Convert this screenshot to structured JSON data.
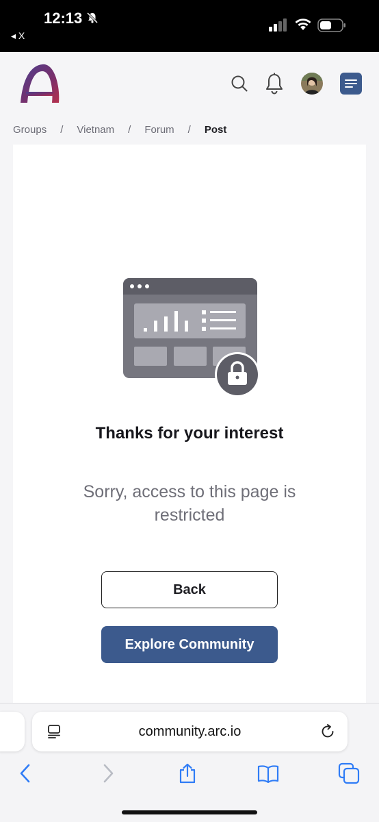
{
  "status_bar": {
    "time": "12:13",
    "back_app": "◂ X"
  },
  "header": {
    "logo_icon": "arc-logo-icon",
    "search_icon": "search-icon",
    "notifications_icon": "bell-icon",
    "menu_icon": "menu-icon",
    "accent_color": "#3c5a8d"
  },
  "breadcrumb": {
    "items": [
      "Groups",
      "Vietnam",
      "Forum"
    ],
    "separator": "/",
    "current": "Post"
  },
  "restricted": {
    "title": "Thanks for your interest",
    "message": "Sorry, access to this page is restricted",
    "back_label": "Back",
    "explore_label": "Explore Community"
  },
  "browser": {
    "url": "community.arc.io"
  }
}
